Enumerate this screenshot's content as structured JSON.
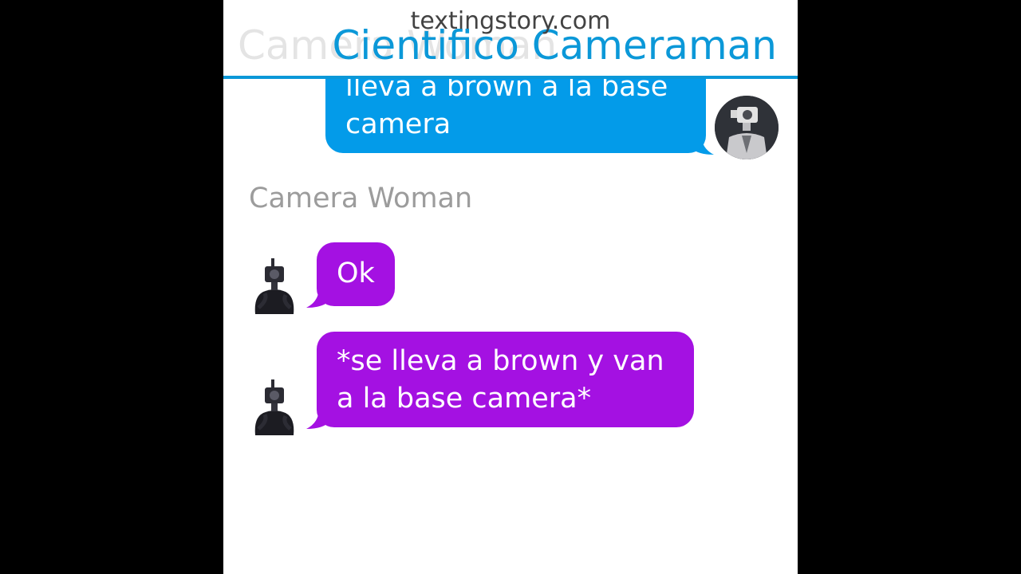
{
  "watermark": "textingstory.com",
  "header": {
    "title": "Cientifico Cameraman",
    "previous_title_ghost": "Camera Woman"
  },
  "conversation": {
    "outgoing_messages": [
      {
        "text": "lleva a brown a la base camera",
        "line1": "lleva a brown a la base",
        "line2": "camera"
      }
    ],
    "incoming_sender": "Camera Woman",
    "incoming_messages": [
      {
        "text": "Ok"
      },
      {
        "text": "*se lleva a brown y van a la base camera*",
        "line1": "*se lleva a brown y van",
        "line2": "a la base camera*"
      }
    ]
  },
  "colors": {
    "accent_blue": "#0b98d8",
    "outgoing_bubble": "#039be9",
    "incoming_bubble": "#a411e2",
    "sender_name": "#9c9c9c",
    "letterbox": "#000000"
  },
  "icons": {
    "outgoing_avatar": "cameraman-avatar",
    "incoming_avatar": "camera-woman-avatar"
  }
}
